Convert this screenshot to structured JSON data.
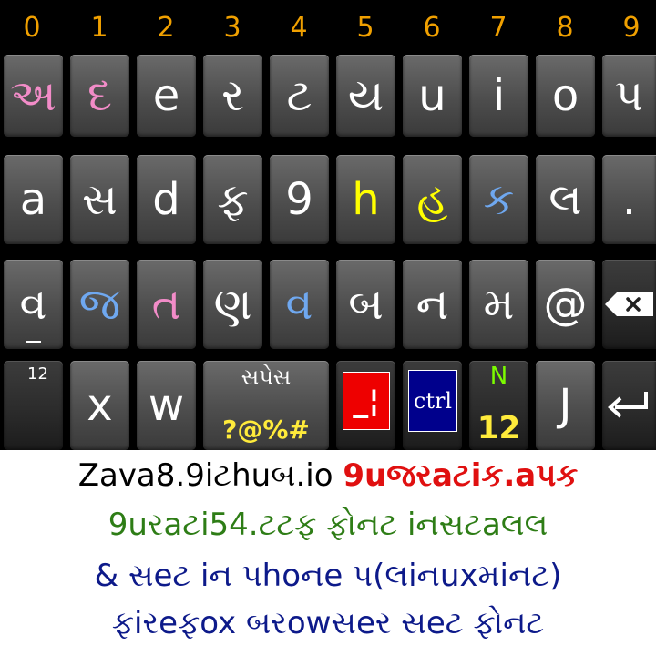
{
  "keyboard": {
    "numbers": [
      "0",
      "1",
      "2",
      "3",
      "4",
      "5",
      "6",
      "7",
      "8",
      "9"
    ],
    "row1": [
      {
        "label": "અ",
        "color": "pink"
      },
      {
        "label": "દ",
        "color": "pink"
      },
      {
        "label": "e",
        "color": "white"
      },
      {
        "label": "ર",
        "color": "white"
      },
      {
        "label": "ટ",
        "color": "white"
      },
      {
        "label": "ય",
        "color": "white"
      },
      {
        "label": "u",
        "color": "white"
      },
      {
        "label": "i",
        "color": "white"
      },
      {
        "label": "o",
        "color": "white"
      },
      {
        "label": "પ",
        "color": "white"
      }
    ],
    "row2": [
      {
        "label": "a",
        "color": "white"
      },
      {
        "label": "સ",
        "color": "white"
      },
      {
        "label": "d",
        "color": "white"
      },
      {
        "label": "ફ",
        "color": "white"
      },
      {
        "label": "9",
        "color": "white"
      },
      {
        "label": "h",
        "color": "yellow"
      },
      {
        "label": "હ",
        "color": "yellow"
      },
      {
        "label": "ક",
        "color": "blue"
      },
      {
        "label": "લ",
        "color": "white"
      },
      {
        "label": ".",
        "color": "white"
      }
    ],
    "row3": [
      {
        "label": "વ",
        "color": "white"
      },
      {
        "label": "જ",
        "color": "blue"
      },
      {
        "label": "ત",
        "color": "pink"
      },
      {
        "label": "ણ",
        "color": "white"
      },
      {
        "label": "વ",
        "color": "blue"
      },
      {
        "label": "બ",
        "color": "white"
      },
      {
        "label": "ન",
        "color": "white"
      },
      {
        "label": "મ",
        "color": "white"
      },
      {
        "label": "@",
        "color": "white"
      }
    ],
    "row4": {
      "first_label": "12",
      "x_label": "x",
      "w_label": "w",
      "space_top": "સપેસ",
      "space_bottom": "?@%#",
      "alt_label": "_¦",
      "ctrl_label": "ctrl",
      "n_top": "N",
      "n_bottom": "12",
      "j_label": "J"
    },
    "icons": {
      "backspace": "backspace-icon",
      "enter": "enter-icon"
    }
  },
  "caption": {
    "line1_black": "Zava8.9iટhuબ.io",
    "line1_red": "9uજરaટiક.aપક",
    "line2": "9uરaટi54.ટટફ ફોનટ iનસટaલલ",
    "line3": "& સeટ iન પhoનe પ(લiનuxમiનટ)",
    "line4": "ફiરeફox બરowસeર સeટ ફોનટ"
  },
  "colors": {
    "pink": "#f28cc8",
    "blue": "#6fa8f0",
    "yellow": "#ffff00",
    "digits": "#f0a000",
    "caption_red": "#e01010",
    "caption_green": "#2e7d16",
    "caption_blue": "#0d1a8a"
  }
}
